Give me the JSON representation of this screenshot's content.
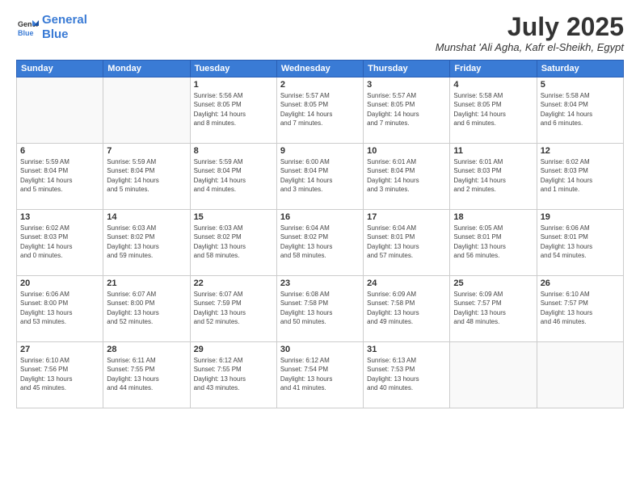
{
  "header": {
    "logo_line1": "General",
    "logo_line2": "Blue",
    "month_year": "July 2025",
    "location": "Munshat 'Ali Agha, Kafr el-Sheikh, Egypt"
  },
  "weekdays": [
    "Sunday",
    "Monday",
    "Tuesday",
    "Wednesday",
    "Thursday",
    "Friday",
    "Saturday"
  ],
  "weeks": [
    [
      {
        "day": "",
        "info": ""
      },
      {
        "day": "",
        "info": ""
      },
      {
        "day": "1",
        "info": "Sunrise: 5:56 AM\nSunset: 8:05 PM\nDaylight: 14 hours\nand 8 minutes."
      },
      {
        "day": "2",
        "info": "Sunrise: 5:57 AM\nSunset: 8:05 PM\nDaylight: 14 hours\nand 7 minutes."
      },
      {
        "day": "3",
        "info": "Sunrise: 5:57 AM\nSunset: 8:05 PM\nDaylight: 14 hours\nand 7 minutes."
      },
      {
        "day": "4",
        "info": "Sunrise: 5:58 AM\nSunset: 8:05 PM\nDaylight: 14 hours\nand 6 minutes."
      },
      {
        "day": "5",
        "info": "Sunrise: 5:58 AM\nSunset: 8:04 PM\nDaylight: 14 hours\nand 6 minutes."
      }
    ],
    [
      {
        "day": "6",
        "info": "Sunrise: 5:59 AM\nSunset: 8:04 PM\nDaylight: 14 hours\nand 5 minutes."
      },
      {
        "day": "7",
        "info": "Sunrise: 5:59 AM\nSunset: 8:04 PM\nDaylight: 14 hours\nand 5 minutes."
      },
      {
        "day": "8",
        "info": "Sunrise: 5:59 AM\nSunset: 8:04 PM\nDaylight: 14 hours\nand 4 minutes."
      },
      {
        "day": "9",
        "info": "Sunrise: 6:00 AM\nSunset: 8:04 PM\nDaylight: 14 hours\nand 3 minutes."
      },
      {
        "day": "10",
        "info": "Sunrise: 6:01 AM\nSunset: 8:04 PM\nDaylight: 14 hours\nand 3 minutes."
      },
      {
        "day": "11",
        "info": "Sunrise: 6:01 AM\nSunset: 8:03 PM\nDaylight: 14 hours\nand 2 minutes."
      },
      {
        "day": "12",
        "info": "Sunrise: 6:02 AM\nSunset: 8:03 PM\nDaylight: 14 hours\nand 1 minute."
      }
    ],
    [
      {
        "day": "13",
        "info": "Sunrise: 6:02 AM\nSunset: 8:03 PM\nDaylight: 14 hours\nand 0 minutes."
      },
      {
        "day": "14",
        "info": "Sunrise: 6:03 AM\nSunset: 8:02 PM\nDaylight: 13 hours\nand 59 minutes."
      },
      {
        "day": "15",
        "info": "Sunrise: 6:03 AM\nSunset: 8:02 PM\nDaylight: 13 hours\nand 58 minutes."
      },
      {
        "day": "16",
        "info": "Sunrise: 6:04 AM\nSunset: 8:02 PM\nDaylight: 13 hours\nand 58 minutes."
      },
      {
        "day": "17",
        "info": "Sunrise: 6:04 AM\nSunset: 8:01 PM\nDaylight: 13 hours\nand 57 minutes."
      },
      {
        "day": "18",
        "info": "Sunrise: 6:05 AM\nSunset: 8:01 PM\nDaylight: 13 hours\nand 56 minutes."
      },
      {
        "day": "19",
        "info": "Sunrise: 6:06 AM\nSunset: 8:01 PM\nDaylight: 13 hours\nand 54 minutes."
      }
    ],
    [
      {
        "day": "20",
        "info": "Sunrise: 6:06 AM\nSunset: 8:00 PM\nDaylight: 13 hours\nand 53 minutes."
      },
      {
        "day": "21",
        "info": "Sunrise: 6:07 AM\nSunset: 8:00 PM\nDaylight: 13 hours\nand 52 minutes."
      },
      {
        "day": "22",
        "info": "Sunrise: 6:07 AM\nSunset: 7:59 PM\nDaylight: 13 hours\nand 52 minutes."
      },
      {
        "day": "23",
        "info": "Sunrise: 6:08 AM\nSunset: 7:58 PM\nDaylight: 13 hours\nand 50 minutes."
      },
      {
        "day": "24",
        "info": "Sunrise: 6:09 AM\nSunset: 7:58 PM\nDaylight: 13 hours\nand 49 minutes."
      },
      {
        "day": "25",
        "info": "Sunrise: 6:09 AM\nSunset: 7:57 PM\nDaylight: 13 hours\nand 48 minutes."
      },
      {
        "day": "26",
        "info": "Sunrise: 6:10 AM\nSunset: 7:57 PM\nDaylight: 13 hours\nand 46 minutes."
      }
    ],
    [
      {
        "day": "27",
        "info": "Sunrise: 6:10 AM\nSunset: 7:56 PM\nDaylight: 13 hours\nand 45 minutes."
      },
      {
        "day": "28",
        "info": "Sunrise: 6:11 AM\nSunset: 7:55 PM\nDaylight: 13 hours\nand 44 minutes."
      },
      {
        "day": "29",
        "info": "Sunrise: 6:12 AM\nSunset: 7:55 PM\nDaylight: 13 hours\nand 43 minutes."
      },
      {
        "day": "30",
        "info": "Sunrise: 6:12 AM\nSunset: 7:54 PM\nDaylight: 13 hours\nand 41 minutes."
      },
      {
        "day": "31",
        "info": "Sunrise: 6:13 AM\nSunset: 7:53 PM\nDaylight: 13 hours\nand 40 minutes."
      },
      {
        "day": "",
        "info": ""
      },
      {
        "day": "",
        "info": ""
      }
    ]
  ]
}
